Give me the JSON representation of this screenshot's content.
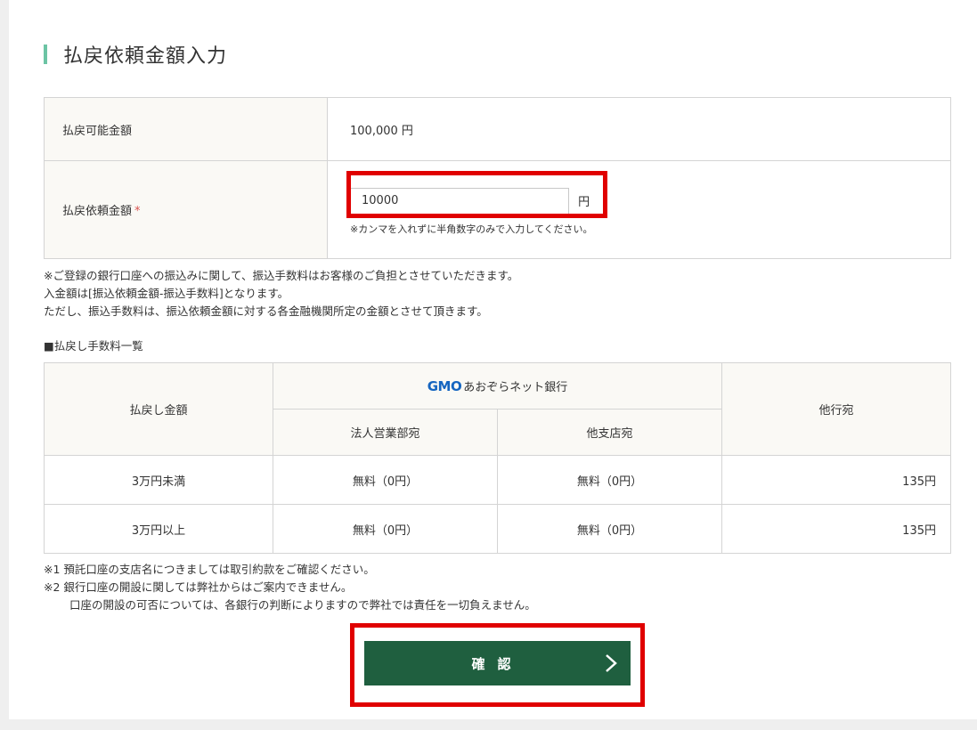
{
  "page": {
    "title": "払戻依頼金額入力"
  },
  "form": {
    "available_label": "払戻可能金額",
    "available_value": "100,000 円",
    "request_label": "払戻依頼金額",
    "required_mark": "*",
    "request_value": "10000",
    "currency": "円",
    "hint": "※カンマを入れずに半角数字のみで入力してください。"
  },
  "notes_top": [
    "※ご登録の銀行口座への振込みに関して、振込手数料はお客様のご負担とさせていただきます。",
    "入金額は[振込依頼金額-振込手数料]となります。",
    "ただし、振込手数料は、振込依頼金額に対する各金融機関所定の金額とさせて頂きます。"
  ],
  "fee_table": {
    "heading": "■払戻し手数料一覧",
    "col_amount": "払戻し金額",
    "bank_logo": "GMO",
    "bank_name": "あおぞらネット銀行",
    "col_corporate": "法人営業部宛",
    "col_branch": "他支店宛",
    "col_other": "他行宛",
    "rows": [
      {
        "amount": "3万円未満",
        "corporate": "無料（0円）",
        "branch": "無料（0円）",
        "other": "135円"
      },
      {
        "amount": "3万円以上",
        "corporate": "無料（0円）",
        "branch": "無料（0円）",
        "other": "135円"
      }
    ]
  },
  "notes_bottom": [
    "※1 預託口座の支店名につきましては取引約款をご確認ください。",
    "※2 銀行口座の開設に関しては弊社からはご案内できません。",
    "口座の開設の可否については、各銀行の判断によりますので弊社では責任を一切負えません。"
  ],
  "button": {
    "label": "確認",
    "icon": "chevron-right-icon"
  },
  "colors": {
    "accent_bar": "#6cc4a4",
    "button_bg": "#1f5f3f",
    "highlight": "#e00000",
    "required": "#d9534f"
  }
}
